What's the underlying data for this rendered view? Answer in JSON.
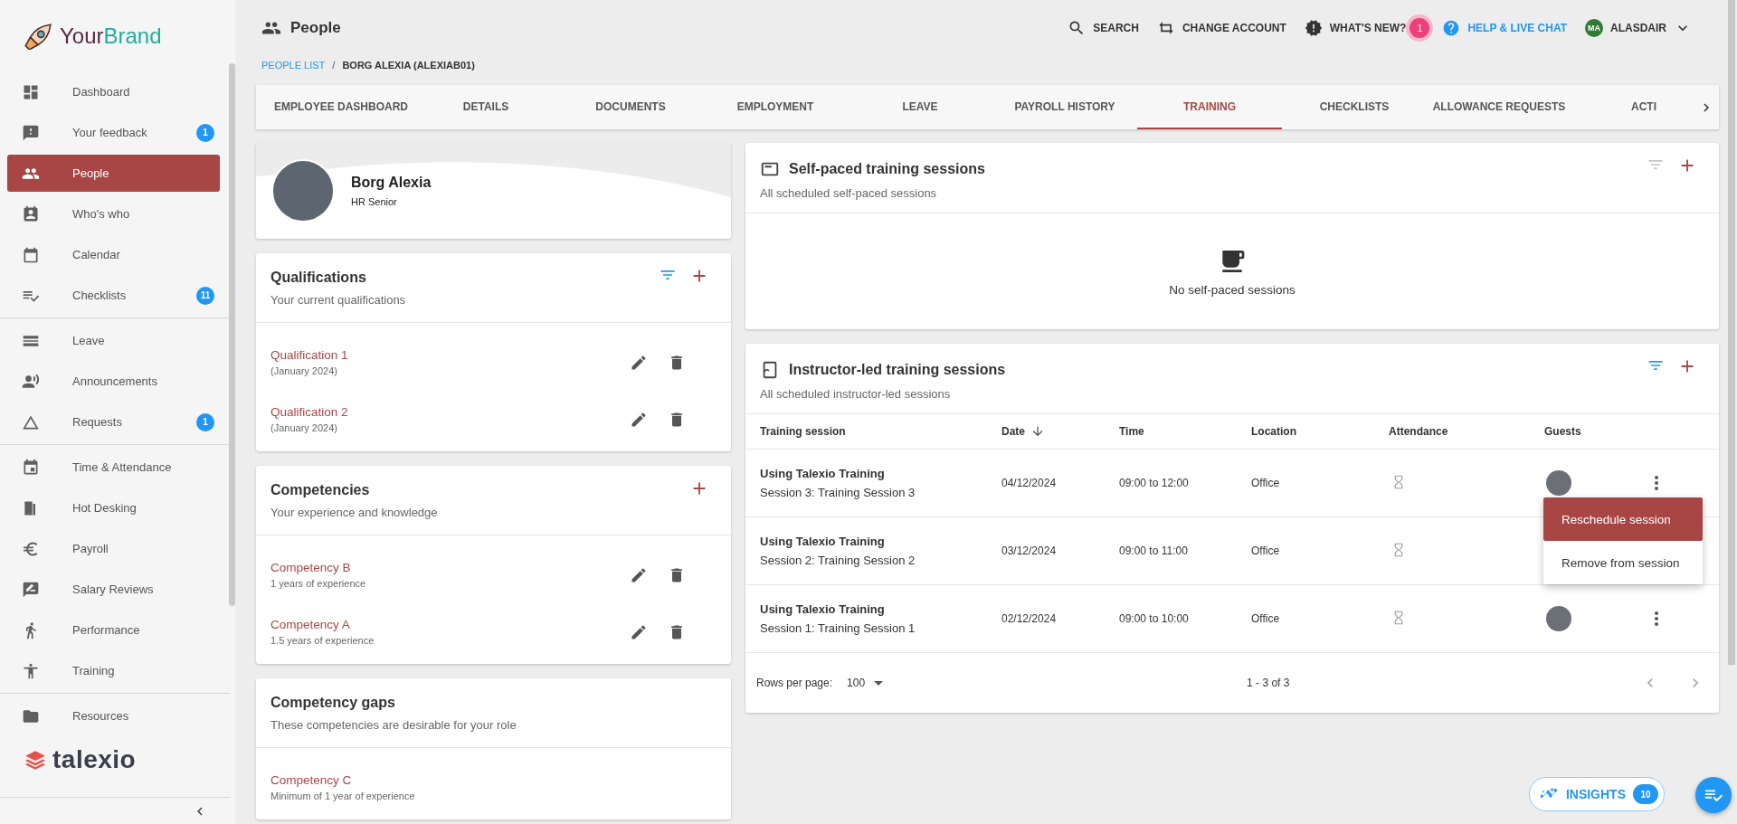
{
  "brand": {
    "first": "Your",
    "second": "Brand"
  },
  "sidebar": {
    "groups": [
      [
        {
          "label": "Dashboard",
          "selected": false
        },
        {
          "label": "Your feedback",
          "selected": false,
          "badge": "1"
        },
        {
          "label": "People",
          "selected": true
        },
        {
          "label": "Who's who",
          "selected": false
        },
        {
          "label": "Calendar",
          "selected": false
        },
        {
          "label": "Checklists",
          "selected": false,
          "badge": "11"
        }
      ],
      [
        {
          "label": "Leave",
          "selected": false
        },
        {
          "label": "Announcements",
          "selected": false
        },
        {
          "label": "Requests",
          "selected": false,
          "badge": "1"
        }
      ],
      [
        {
          "label": "Time & Attendance",
          "selected": false
        },
        {
          "label": "Hot Desking",
          "selected": false
        },
        {
          "label": "Payroll",
          "selected": false
        },
        {
          "label": "Salary Reviews",
          "selected": false
        },
        {
          "label": "Performance",
          "selected": false
        },
        {
          "label": "Training",
          "selected": false
        }
      ],
      [
        {
          "label": "Resources",
          "selected": false
        }
      ]
    ],
    "footer_logo": "talexio"
  },
  "header": {
    "title": "People",
    "actions": [
      {
        "label": "SEARCH",
        "kind": "search"
      },
      {
        "label": "CHANGE ACCOUNT",
        "kind": "switch"
      },
      {
        "label": "WHAT'S NEW?",
        "kind": "news",
        "badge": "1"
      },
      {
        "label": "HELP & LIVE CHAT",
        "kind": "help"
      }
    ],
    "user": {
      "initials": "MA",
      "name": "ALASDAIR"
    }
  },
  "breadcrumb": {
    "items": [
      "PEOPLE LIST",
      "BORG ALEXIA (ALEXIAB01)"
    ],
    "separator": "/"
  },
  "tabs": [
    {
      "label": "EMPLOYEE DASHBOARD",
      "selected": false
    },
    {
      "label": "DETAILS",
      "selected": false
    },
    {
      "label": "DOCUMENTS",
      "selected": false
    },
    {
      "label": "EMPLOYMENT",
      "selected": false
    },
    {
      "label": "LEAVE",
      "selected": false
    },
    {
      "label": "PAYROLL HISTORY",
      "selected": false
    },
    {
      "label": "TRAINING",
      "selected": true
    },
    {
      "label": "CHECKLISTS",
      "selected": false
    },
    {
      "label": "ALLOWANCE REQUESTS",
      "selected": false
    },
    {
      "label": "ACTI",
      "selected": false
    }
  ],
  "profile": {
    "name": "Borg Alexia",
    "role": "HR Senior"
  },
  "left_cards": [
    {
      "title": "Qualifications",
      "subtitle": "Your current qualifications",
      "filter": {
        "active": true
      },
      "add": true,
      "editable": true,
      "items": [
        {
          "title": "Qualification 1",
          "detail": "(January 2024)"
        },
        {
          "title": "Qualification 2",
          "detail": "(January 2024)"
        }
      ]
    },
    {
      "title": "Competencies",
      "subtitle": "Your experience and knowledge",
      "add": true,
      "editable": true,
      "items": [
        {
          "title": "Competency B",
          "detail": "1 years of experience"
        },
        {
          "title": "Competency A",
          "detail": "1.5 years of experience"
        }
      ]
    },
    {
      "title": "Competency gaps",
      "subtitle": "These competencies are desirable for your role",
      "add": false,
      "editable": false,
      "items": [
        {
          "title": "Competency C",
          "detail": "Minimum of 1 year of experience"
        }
      ]
    }
  ],
  "self_paced": {
    "title": "Self-paced training sessions",
    "subtitle": "All scheduled self-paced sessions",
    "filter": {
      "active": false
    },
    "empty_text": "No self-paced sessions"
  },
  "instructor_led": {
    "title": "Instructor-led training sessions",
    "subtitle": "All scheduled instructor-led sessions",
    "filter": {
      "active": true
    },
    "columns": [
      {
        "label": "Training session",
        "sorted": false
      },
      {
        "label": "Date",
        "sorted": true
      },
      {
        "label": "Time",
        "sorted": false
      },
      {
        "label": "Location",
        "sorted": false
      },
      {
        "label": "Attendance",
        "sorted": false
      },
      {
        "label": "Guests",
        "sorted": false
      }
    ],
    "rows": [
      {
        "title": "Using Talexio Training",
        "session": "Session 3: Training Session 3",
        "date": "04/12/2024",
        "time": "09:00 to 12:00",
        "location": "Office",
        "menu_open": true
      },
      {
        "title": "Using Talexio Training",
        "session": "Session 2: Training Session 2",
        "date": "03/12/2024",
        "time": "09:00 to 11:00",
        "location": "Office",
        "menu_open": false
      },
      {
        "title": "Using Talexio Training",
        "session": "Session 1: Training Session 1",
        "date": "02/12/2024",
        "time": "09:00 to 10:00",
        "location": "Office",
        "menu_open": false
      }
    ],
    "menu": [
      {
        "label": "Reschedule session",
        "selected": true
      },
      {
        "label": "Remove from session",
        "selected": false
      }
    ],
    "footer": {
      "rows_per_page_label": "Rows per page:",
      "rows_per_page": "100",
      "range": "1 - 3 of 3"
    }
  },
  "insights": {
    "label": "INSIGHTS",
    "badge": "10"
  }
}
